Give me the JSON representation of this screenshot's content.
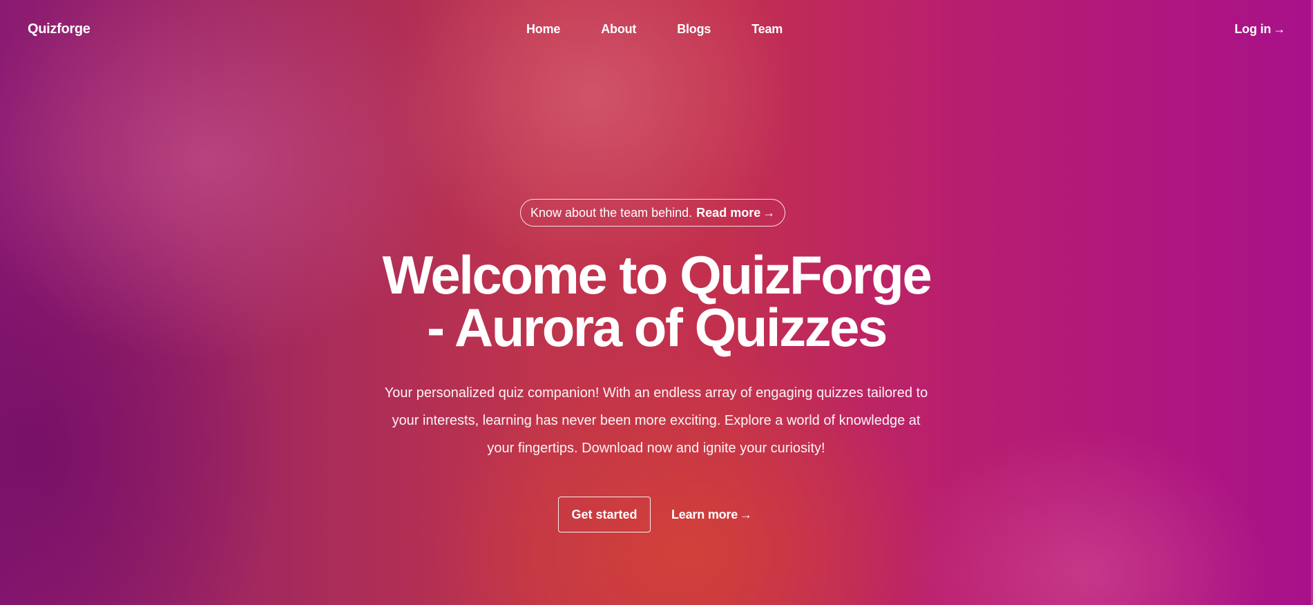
{
  "nav": {
    "brand": "Quizforge",
    "items": [
      {
        "label": "Home"
      },
      {
        "label": "About"
      },
      {
        "label": "Blogs"
      },
      {
        "label": "Team"
      }
    ],
    "login_label": "Log in",
    "login_icon": "→"
  },
  "announcement": {
    "text": "Know about the team behind.",
    "link_label": "Read more",
    "link_icon": "→"
  },
  "hero": {
    "title_line1": "Welcome to QuizForge",
    "title_line2": "- Aurora of Quizzes",
    "subtitle_line1": "Your personalized quiz companion! With an endless array of engaging quizzes tailored to",
    "subtitle_line2": "your interests, learning has never been more exciting. Explore a world of knowledge at",
    "subtitle_line3": "your fingertips. Download now and ignite your curiosity!"
  },
  "actions": {
    "get_started_label": "Get started",
    "learn_more_label": "Learn more",
    "learn_more_icon": "→"
  },
  "colors": {
    "text": "#ffffff",
    "gradient_left": "#8a1a72",
    "gradient_center": "#c0344c",
    "gradient_right": "#a8118a"
  }
}
